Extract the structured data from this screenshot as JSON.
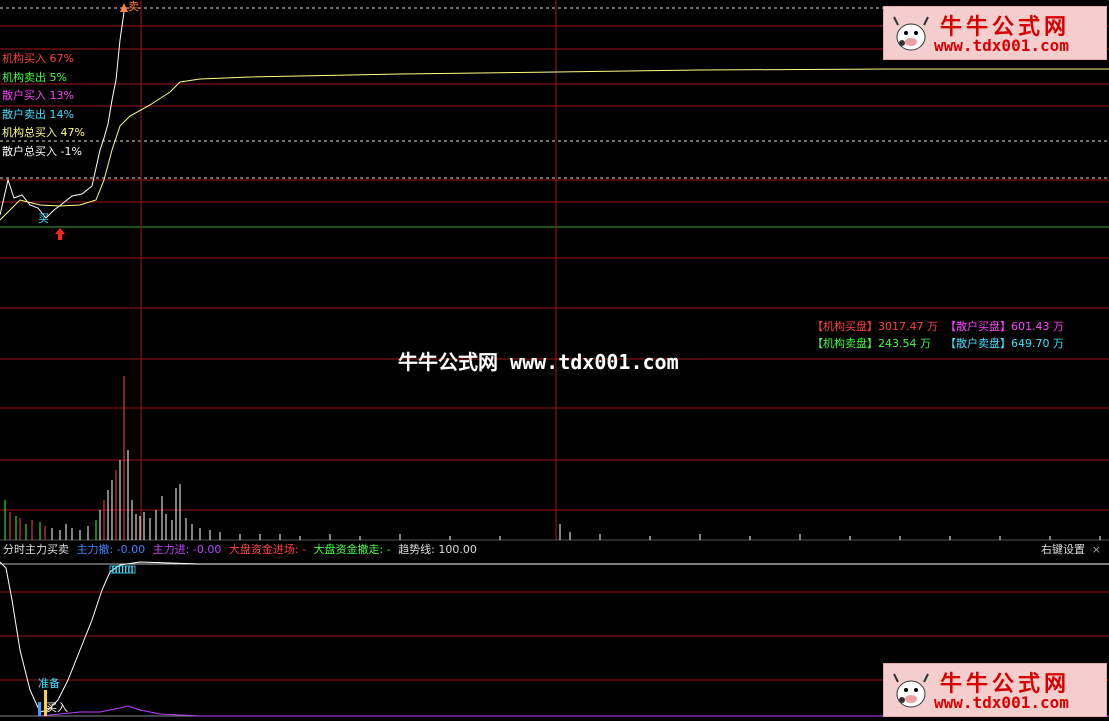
{
  "main_chart": {
    "stats": [
      {
        "label": "机构买入 67%",
        "color": "#ff4040"
      },
      {
        "label": "机构卖出 5%",
        "color": "#40ff40"
      },
      {
        "label": "散户买入 13%",
        "color": "#ff40ff"
      },
      {
        "label": "散户卖出 14%",
        "color": "#40e0ff"
      },
      {
        "label": "机构总买入 47%",
        "color": "#ffff80"
      },
      {
        "label": "散户总买入 -1%",
        "color": "#ffffff"
      }
    ],
    "sell_marker": "卖",
    "buy_marker": "买"
  },
  "order_panel": {
    "inst_buy_label": "【机构买盘】",
    "inst_buy_value": "3017.47 万",
    "retail_buy_label": "【散户买盘】",
    "retail_buy_value": "601.43 万",
    "inst_sell_label": "【机构卖盘】",
    "inst_sell_value": "243.54 万",
    "retail_sell_label": "【散户卖盘】",
    "retail_sell_value": "649.70 万"
  },
  "watermark": "牛牛公式网 www.tdx001.com",
  "logo": {
    "cn": "牛牛公式网",
    "url": "www.tdx001.com"
  },
  "indicator_bar": {
    "name": "分时主力买卖",
    "zl_out": "主力撤: -0.00",
    "zl_in": "主力进: -0.00",
    "dp_in": "大盘资金进场: -",
    "dp_out": "大盘资金撤走: -",
    "trend": "趋势线: 100.00",
    "settings": "右键设置",
    "close": "×"
  },
  "lower_chart": {
    "ready_label": "准备",
    "buy_label": "买入"
  },
  "colors": {
    "grid": "#a01818",
    "price_line": "#ffffff",
    "avg_line": "#ffff80",
    "trend_line": "#ffffff",
    "purple_line": "#c040ff",
    "volume": "#ffffff"
  }
}
